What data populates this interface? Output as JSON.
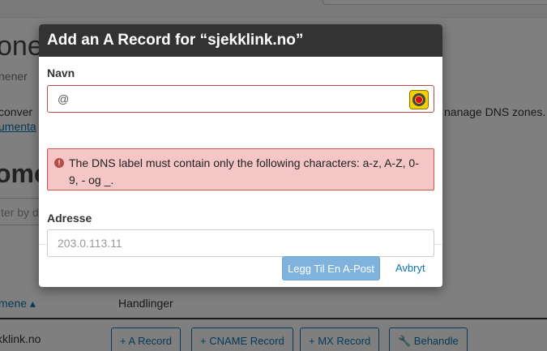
{
  "background": {
    "page_title": "one",
    "page_subtitle": "nener",
    "description": "conver",
    "description_link": "umenta",
    "description_right": "nanage DNS zones. F",
    "section_heading": "ome",
    "filter_placeholder": "ter by d",
    "table": {
      "col_domain": "mene ▴",
      "col_actions": "Handlinger",
      "row_domain": "kklink.no",
      "actions": [
        "+ A Record",
        "+ CNAME Record",
        "+ MX Record",
        "🔧 Behandle"
      ]
    }
  },
  "modal": {
    "title": "Add an A Record for “sjekklink.no”",
    "name_label": "Navn",
    "name_value": "@",
    "error_text": "The DNS label must contain only the following characters: a-z, A-Z, 0-9, - og _.",
    "address_label": "Adresse",
    "address_placeholder": "203.0.113.11",
    "submit_label": "Legg Til En A-Post",
    "cancel_label": "Avbryt"
  },
  "colors": {
    "header_bg": "#333333",
    "error_bg": "#f5c6c6",
    "error_border": "#d9534f",
    "primary_btn": "#7fb3de",
    "link": "#0b75b4",
    "extension_icon": "#f5d000"
  },
  "icons": [
    "exclamation-circle-icon",
    "browser-extension-icon"
  ]
}
